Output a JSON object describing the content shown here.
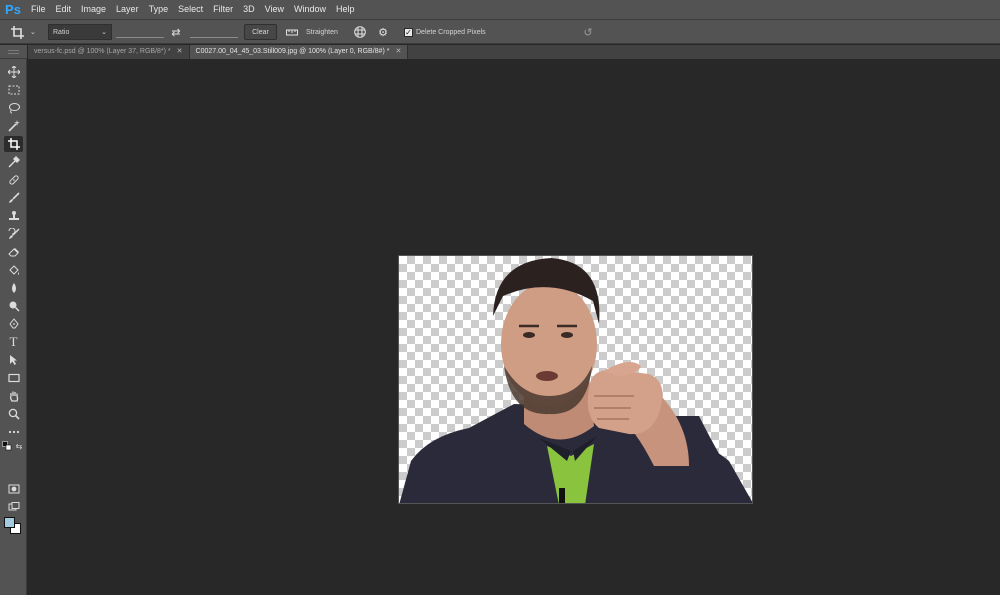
{
  "app": {
    "logo": "Ps"
  },
  "menu": [
    "File",
    "Edit",
    "Image",
    "Layer",
    "Type",
    "Select",
    "Filter",
    "3D",
    "View",
    "Window",
    "Help"
  ],
  "options": {
    "ratio_select": "Ratio",
    "clear_label": "Clear",
    "straighten_label": "Straighten",
    "delete_cropped_label": "Delete Cropped Pixels",
    "delete_cropped_checked": true
  },
  "tabs": [
    {
      "label": "versus-fc.psd @ 100% (Layer 37, RGB/8*) *",
      "active": false
    },
    {
      "label": "C0027.00_04_45_03.Still009.jpg @ 100% (Layer 0, RGB/8#) *",
      "active": true
    }
  ],
  "tools": [
    "move-icon",
    "marquee-icon",
    "lasso-icon",
    "magic-wand-icon",
    "crop-icon",
    "eyedropper-icon",
    "healing-brush-icon",
    "brush-icon",
    "clone-stamp-icon",
    "history-brush-icon",
    "eraser-icon",
    "paint-bucket-icon",
    "blur-icon",
    "dodge-icon",
    "pen-icon",
    "type-icon",
    "path-selection-icon",
    "rectangle-icon",
    "hand-icon",
    "zoom-icon",
    "more-tools-icon"
  ],
  "type_tool_label": "T",
  "colors": {
    "foreground": "#a4cce0",
    "background": "#ffffff",
    "ps_blue": "#31a8ff"
  }
}
